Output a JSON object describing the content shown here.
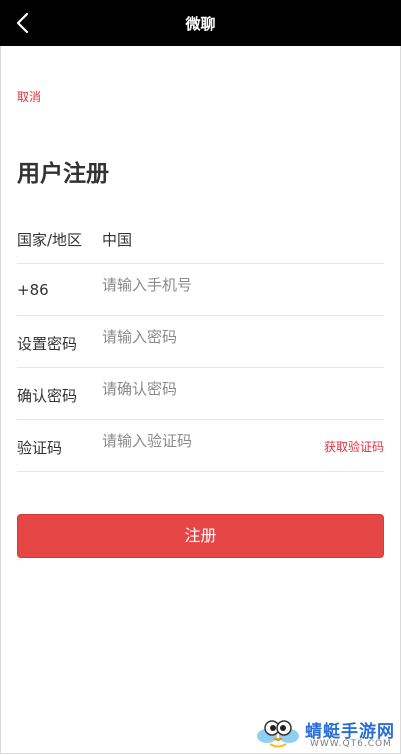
{
  "nav": {
    "title": "微聊"
  },
  "cancel_label": "取消",
  "page_title": "用户注册",
  "form": {
    "country": {
      "label": "国家/地区",
      "value": "中国"
    },
    "phone": {
      "label": "+86",
      "placeholder": "请输入手机号"
    },
    "password": {
      "label": "设置密码",
      "placeholder": "请输入密码"
    },
    "confirm": {
      "label": "确认密码",
      "placeholder": "请确认密码"
    },
    "code": {
      "label": "验证码",
      "placeholder": "请输入验证码",
      "get_code_label": "获取验证码"
    }
  },
  "submit_label": "注册",
  "watermark": {
    "text": "蜻蜓手游网",
    "url": "WWW.QT6.COM"
  },
  "colors": {
    "accent": "#e74646",
    "link": "#e0323e",
    "nav_bg": "#000000"
  },
  "icons": {
    "back": "chevron-left-icon",
    "watermark_logo": "dragonfly-logo-icon"
  }
}
